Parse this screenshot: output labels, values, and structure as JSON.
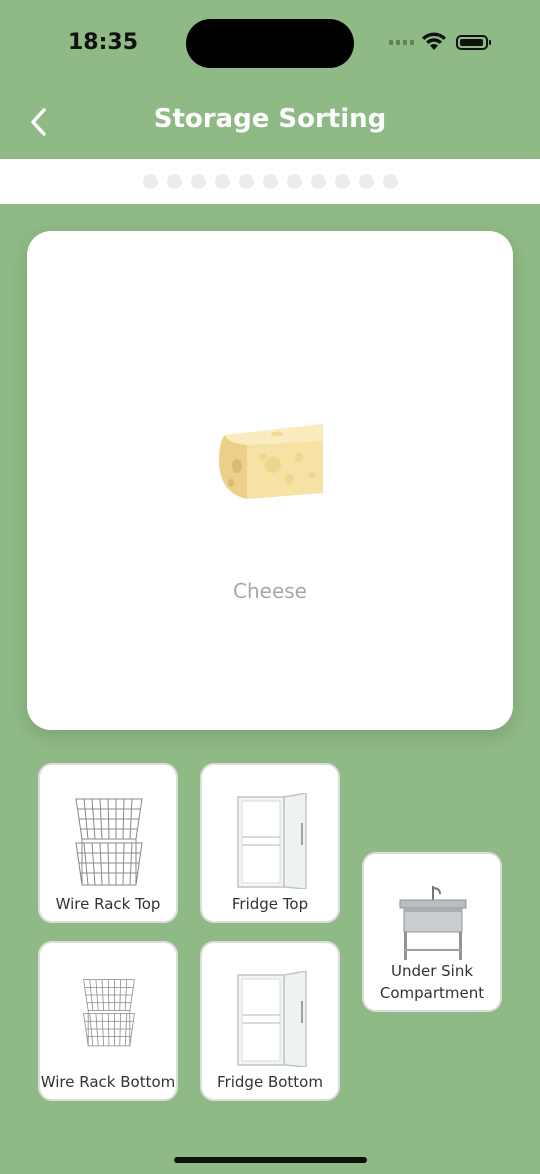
{
  "status_bar": {
    "time": "18:35"
  },
  "header": {
    "title": "Storage Sorting"
  },
  "progress": {
    "total": 11,
    "completed": 0
  },
  "card": {
    "item_name": "Cheese",
    "icon": "cheese-icon"
  },
  "options": {
    "wire_rack_top": {
      "label": "Wire Rack Top",
      "icon": "wire-rack-icon"
    },
    "fridge_top": {
      "label": "Fridge Top",
      "icon": "fridge-icon"
    },
    "under_sink": {
      "label": "Under Sink Compartment",
      "icon": "sink-icon"
    },
    "wire_rack_bottom": {
      "label": "Wire Rack Bottom",
      "icon": "wire-rack-icon"
    },
    "fridge_bottom": {
      "label": "Fridge Bottom",
      "icon": "fridge-icon"
    }
  },
  "colors": {
    "background": "#8fb985",
    "card": "#ffffff",
    "dot": "#ececec"
  }
}
